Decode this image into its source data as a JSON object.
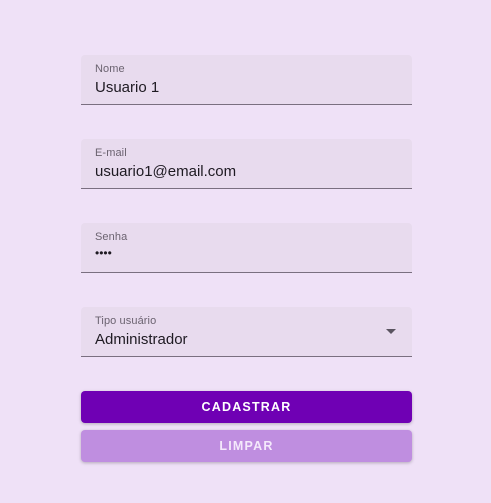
{
  "form": {
    "fields": [
      {
        "label": "Nome",
        "value": "Usuario 1"
      },
      {
        "label": "E-mail",
        "value": "usuario1@email.com"
      },
      {
        "label": "Senha",
        "value": "••••"
      },
      {
        "label": "Tipo usuário",
        "value": "Administrador"
      }
    ],
    "buttons": {
      "submit_label": "CADASTRAR",
      "clear_label": "LIMPAR"
    }
  },
  "colors": {
    "background": "#efe1f7",
    "field_background": "#e8dbee",
    "primary": "#6f00b4",
    "secondary": "#bf8ee0"
  },
  "icons": {
    "select_caret": "chevron-down-icon"
  }
}
